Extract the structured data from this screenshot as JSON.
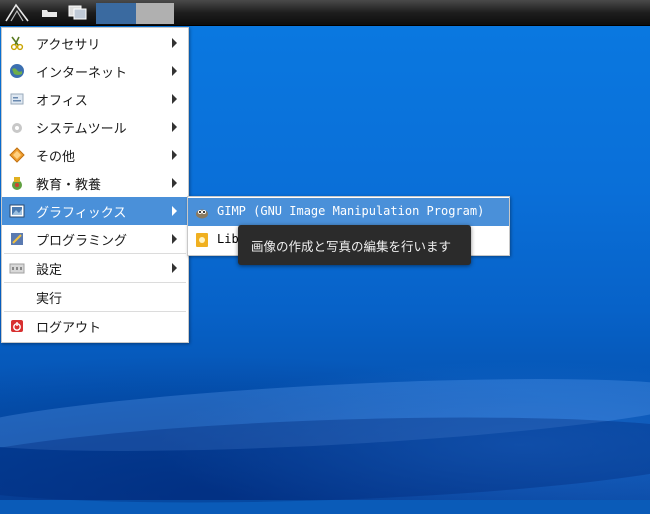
{
  "menu": {
    "items": [
      {
        "label": "アクセサリ",
        "icon": "scissors-accessories-icon",
        "submenu": true
      },
      {
        "label": "インターネット",
        "icon": "globe-icon",
        "submenu": true
      },
      {
        "label": "オフィス",
        "icon": "office-document-icon",
        "submenu": true
      },
      {
        "label": "システムツール",
        "icon": "gear-icon",
        "submenu": true
      },
      {
        "label": "その他",
        "icon": "diamond-misc-icon",
        "submenu": true
      },
      {
        "label": "教育・教養",
        "icon": "education-icon",
        "submenu": true
      },
      {
        "label": "グラフィックス",
        "icon": "graphics-icon",
        "submenu": true,
        "active": true
      },
      {
        "label": "プログラミング",
        "icon": "programming-icon",
        "submenu": true
      },
      {
        "label": "設定",
        "icon": "settings-icon",
        "submenu": true
      },
      {
        "label": "実行",
        "icon": "",
        "submenu": false
      },
      {
        "label": "ログアウト",
        "icon": "logout-icon",
        "submenu": false
      }
    ]
  },
  "submenu": {
    "items": [
      {
        "label": "GIMP (GNU Image Manipulation Program)",
        "icon": "gimp-icon",
        "active": true
      },
      {
        "label": "Lib",
        "icon": "libreoffice-draw-icon",
        "active": false
      }
    ]
  },
  "tooltip": {
    "text": "画像の作成と写真の編集を行います"
  },
  "colors": {
    "highlight": "#4a90d9",
    "desktop": "#0a6fd8",
    "tooltip_bg": "#2b2b2b"
  }
}
